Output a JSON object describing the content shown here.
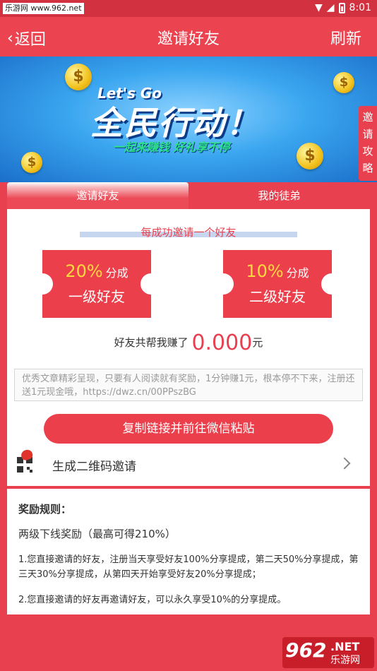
{
  "statusbar": {
    "watermark": "乐游网 www.962.net",
    "time": "8:01"
  },
  "appbar": {
    "back_label": "返回",
    "title": "邀请好友",
    "refresh_label": "刷新"
  },
  "banner": {
    "lets_go": "Let's Go",
    "headline": "全民行动！",
    "subline": "一起来赚钱 好礼享不停",
    "coin_symbol": "$"
  },
  "guide_tab": {
    "label": "邀请攻略"
  },
  "tabs": [
    {
      "label": "邀请好友",
      "active": true
    },
    {
      "label": "我的徒弟",
      "active": false
    }
  ],
  "invite": {
    "headline": "每成功邀请一个好友",
    "tiers": [
      {
        "percent": "20%",
        "unit": "分成",
        "level": "一级好友"
      },
      {
        "percent": "10%",
        "unit": "分成",
        "level": "二级好友"
      }
    ],
    "earn_prefix": "好友共帮我赚了",
    "earn_amount": "0.000",
    "earn_suffix": "元",
    "share_text": "优秀文章精彩呈现，只要有人阅读就有奖励，1分钟赚1元，根本停不下来，注册还送1元现金哦，https://dwz.cn/00PPszBG",
    "copy_button": "复制链接并前往微信粘贴",
    "qr_label": "生成二维码邀请"
  },
  "rules": {
    "title": "奖励规则：",
    "line1": "两级下线奖励（最高可得210%）",
    "line2": "1.您直接邀请的好友，注册当天享受好友100%分享提成，第二天50%分享提成，第三天30%分享提成，从第四天开始享受好友20%分享提成；",
    "line3": "2.您直接邀请的好友再邀请好友，可以永久享受10%的分享提成。"
  },
  "watermark_logo": {
    "number": "962",
    "net": ".NET",
    "name": "乐游网"
  },
  "colors": {
    "primary": "#ec3f4c",
    "statusbar": "#d2323f",
    "accent_yellow": "#ffd93d"
  }
}
